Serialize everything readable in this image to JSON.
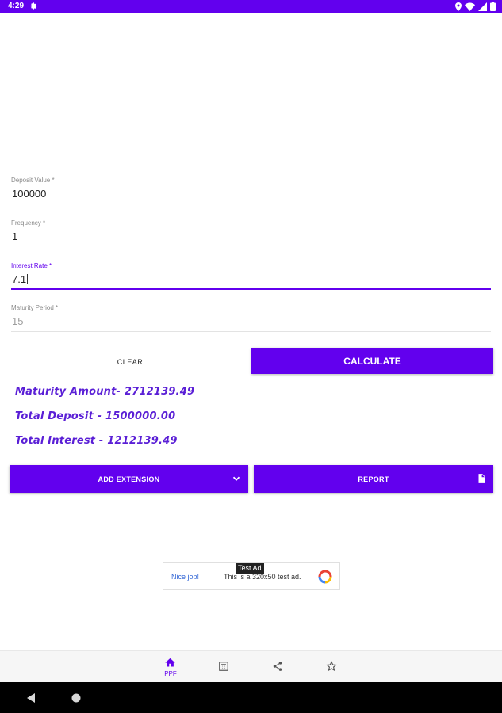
{
  "status_bar": {
    "time": "4:29",
    "icons": [
      "gear-icon",
      "location-icon",
      "wifi-icon",
      "signal-icon",
      "battery-icon"
    ]
  },
  "form": {
    "deposit": {
      "label": "Deposit Value *",
      "value": "100000"
    },
    "frequency": {
      "label": "Frequency *",
      "value": "1"
    },
    "interest": {
      "label": "Interest Rate *",
      "value": "7.1"
    },
    "maturity": {
      "label": "Maturity Period *",
      "value": "15"
    }
  },
  "actions": {
    "clear_label": "CLEAR",
    "calculate_label": "CALCULATE"
  },
  "results": {
    "maturity": "Maturity Amount-  2712139.49",
    "total_deposit": "Total Deposit -  1500000.00",
    "total_interest": "Total Interest -  1212139.49"
  },
  "buttons": {
    "add_extension": "ADD EXTENSION",
    "report": "REPORT"
  },
  "ad": {
    "tag": "Test Ad",
    "nice": "Nice job!",
    "text": "This is a 320x50 test ad."
  },
  "bottom_nav": {
    "items": [
      {
        "label": "PPF",
        "icon": "home-icon",
        "active": true
      },
      {
        "label": "",
        "icon": "calculator-icon",
        "active": false
      },
      {
        "label": "",
        "icon": "share-icon",
        "active": false
      },
      {
        "label": "",
        "icon": "star-icon",
        "active": false
      }
    ]
  },
  "colors": {
    "primary": "#6200ee",
    "result_text": "#5a1fd6"
  }
}
